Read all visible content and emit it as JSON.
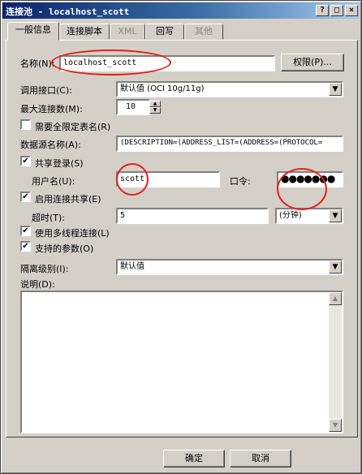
{
  "window": {
    "title": "连接池 - localhost_scott",
    "help_btn": "?",
    "max_btn": "□",
    "close_btn": "×"
  },
  "tabs": [
    {
      "label": "一般信息",
      "active": true,
      "enabled": true
    },
    {
      "label": "连接脚本",
      "active": false,
      "enabled": true
    },
    {
      "label": "XML",
      "active": false,
      "enabled": false
    },
    {
      "label": "回写",
      "active": false,
      "enabled": true
    },
    {
      "label": "其他",
      "active": false,
      "enabled": false
    }
  ],
  "form": {
    "name_label": "名称(N):",
    "name_value": "localhost_scott",
    "permissions_button": "权限(P)...",
    "call_interface_label": "调用接口(C):",
    "call_interface_value": "默认值 (OCI 10g/11g)",
    "max_connections_label": "最大连接数(M):",
    "max_connections_value": "10",
    "require_fq_names_label": "需要全限定表名(R)",
    "require_fq_names_checked": false,
    "dsn_label": "数据源名称(A):",
    "dsn_value": "(DESCRIPTION=(ADDRESS_LIST=(ADDRESS=(PROTOCOL=",
    "shared_login_label": "共享登录(S)",
    "shared_login_checked": true,
    "username_label": "用户名(U):",
    "username_value": "scott",
    "password_label": "口令:",
    "password_value": "●●●●●●●",
    "enable_sharing_label": "启用连接共享(E)",
    "enable_sharing_checked": true,
    "timeout_label": "超时(T):",
    "timeout_value": "5",
    "timeout_unit": "(分钟)",
    "multithread_label": "使用多线程连接(L)",
    "multithread_checked": true,
    "params_supported_label": "支持的参数(O)",
    "params_supported_checked": true,
    "isolation_label": "隔离级别(I):",
    "isolation_value": "默认值",
    "description_label": "说明(D):",
    "description_value": ""
  },
  "footer": {
    "ok_button": "确定",
    "cancel_button": "取消"
  },
  "glyphs": {
    "check": "✔",
    "arrow_down": "▼",
    "arrow_up": "▲"
  },
  "annotation_color": "#e0211b"
}
